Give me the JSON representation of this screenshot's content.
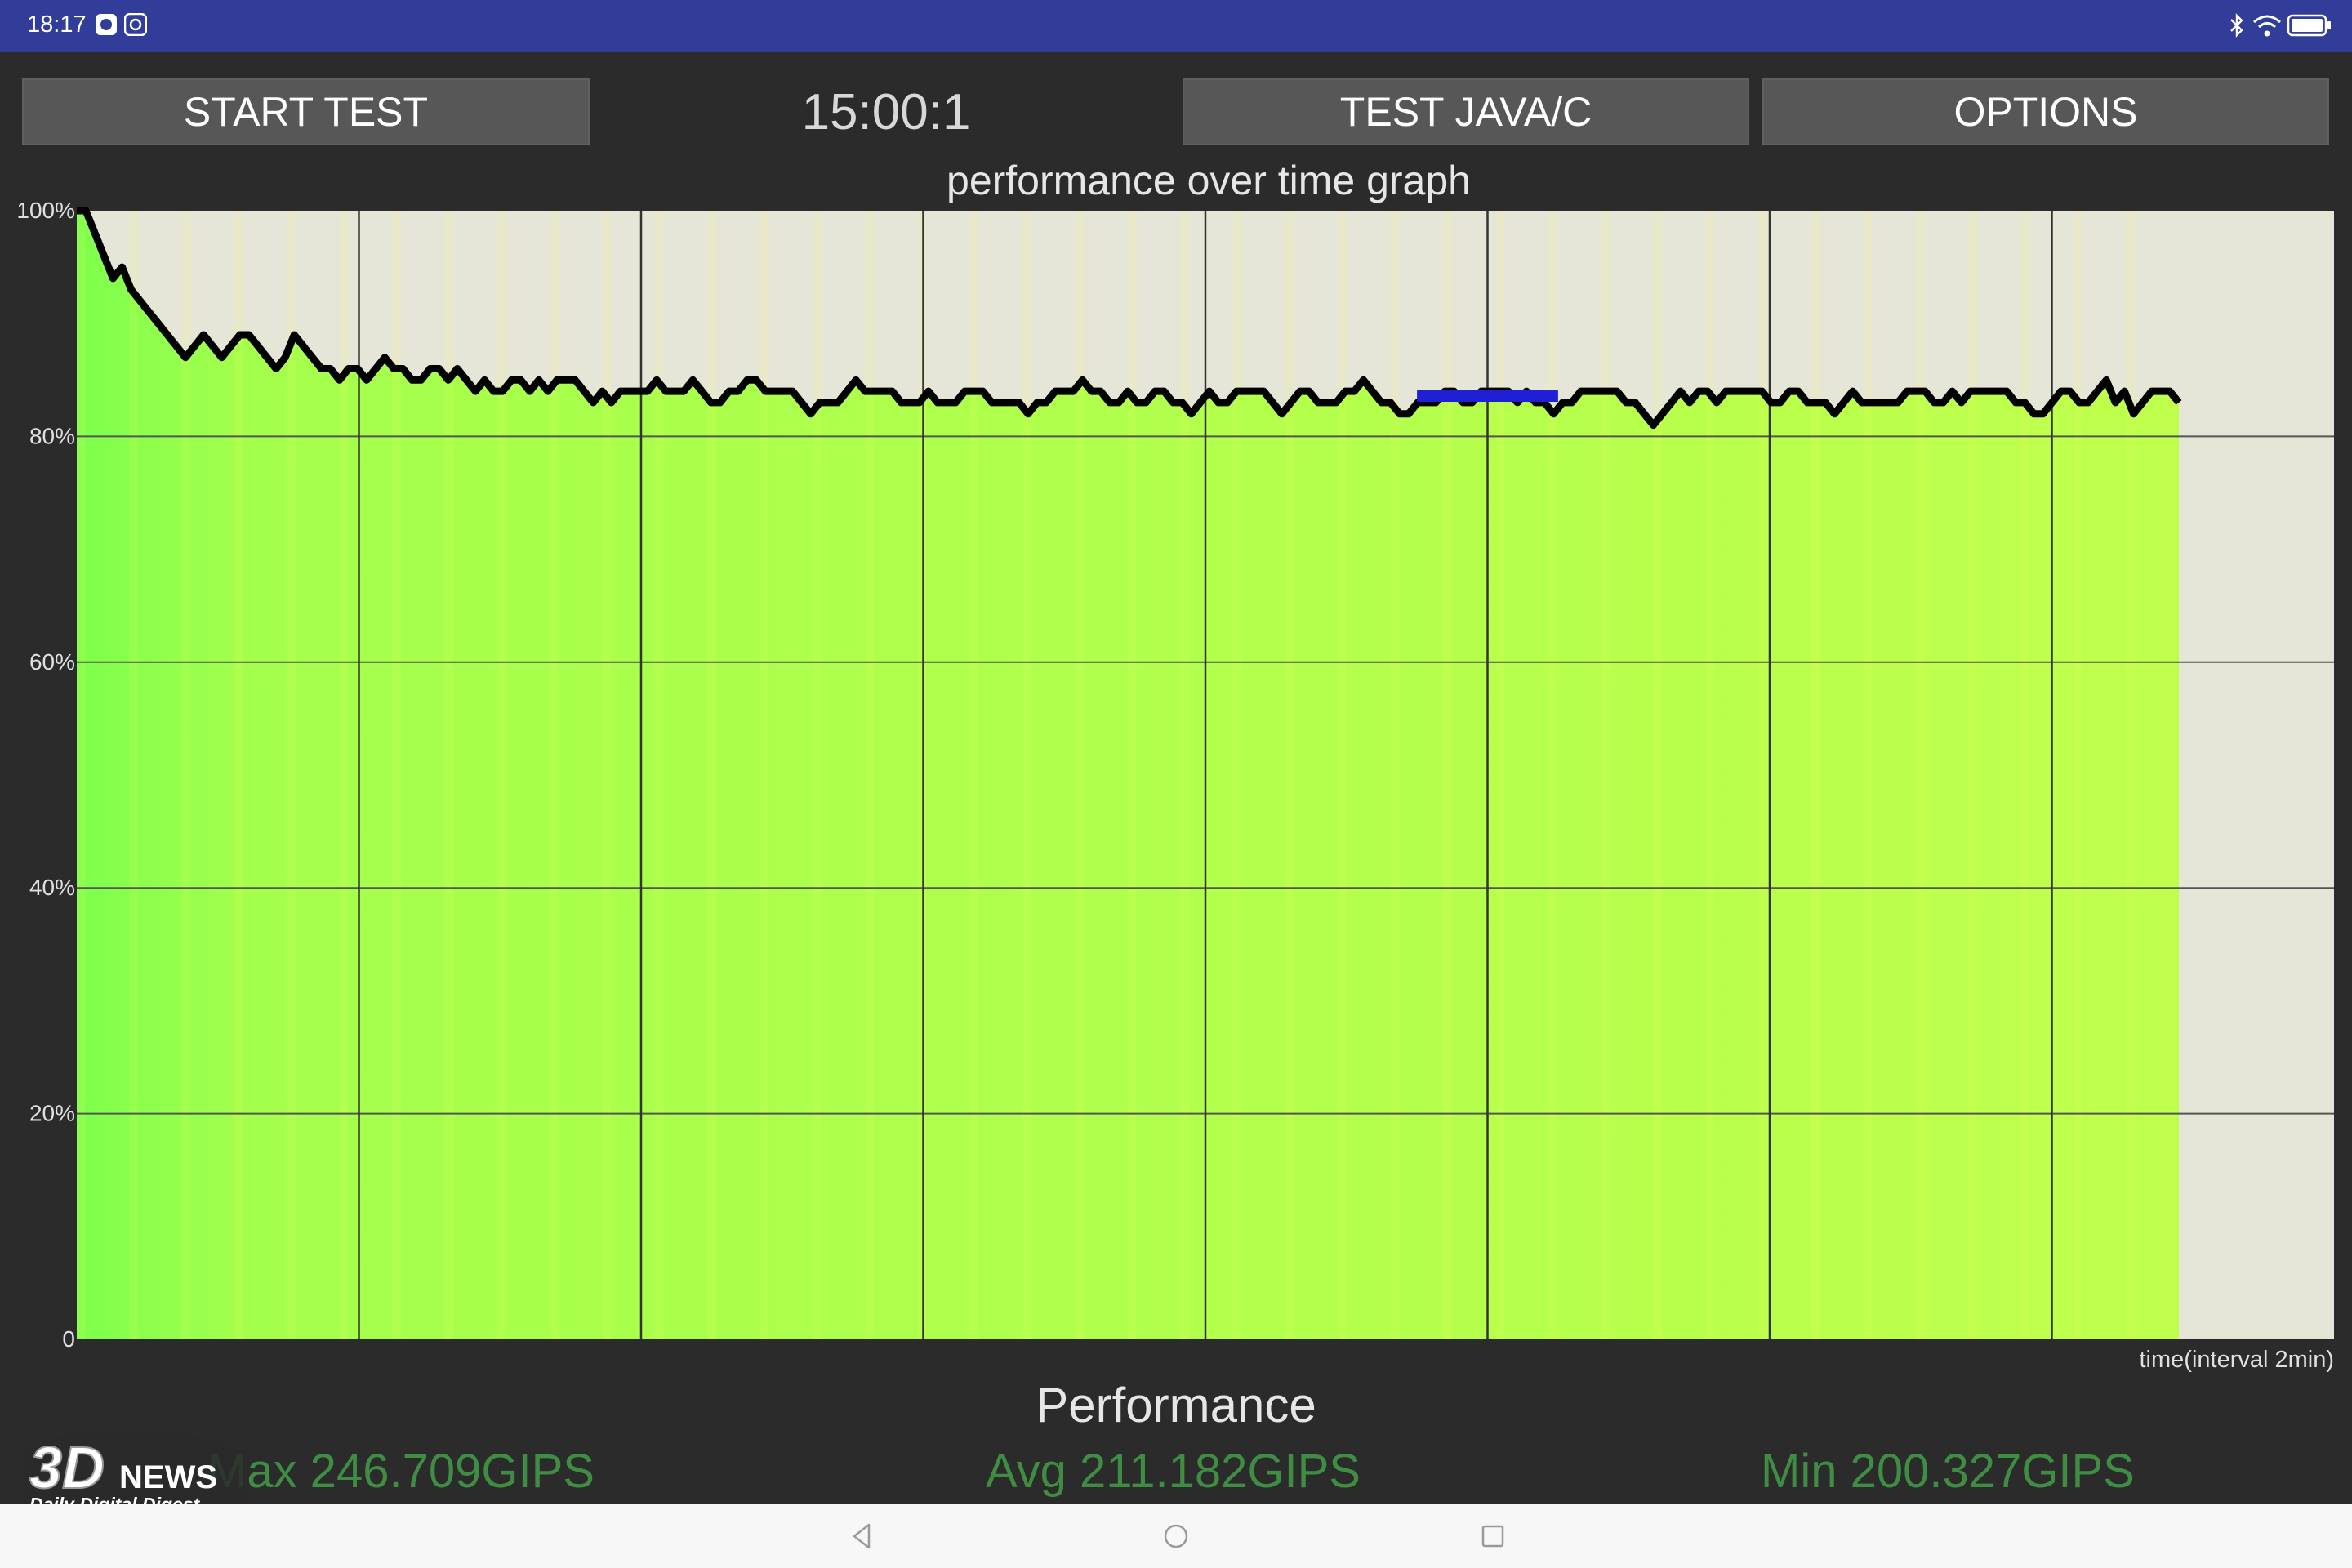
{
  "status_bar": {
    "time": "18:17",
    "left_icons": [
      "app-notification-icon",
      "settings-notification-icon"
    ],
    "right_icons": [
      "bluetooth-icon",
      "wifi-icon",
      "battery-icon"
    ]
  },
  "toolbar": {
    "start_label": "START TEST",
    "timer": "15:00:1",
    "java_label": "TEST JAVA/C",
    "options_label": "OPTIONS"
  },
  "chart_data": {
    "type": "area",
    "title": "performance over time graph",
    "xlabel": "time(interval 2min)",
    "ylabel": "",
    "ytick_labels": [
      "100%",
      "80%",
      "60%",
      "40%",
      "20%",
      "0"
    ],
    "ylim": [
      0,
      100
    ],
    "x_interval_minutes": 2,
    "xlim_minutes": [
      0,
      16
    ],
    "grid": true,
    "colors": {
      "fill_start": "#7cff4c",
      "fill_end": "#bfff4c",
      "line": "#000000",
      "highlight": "#1f1fd6",
      "empty": "#e6e6d8"
    },
    "series": [
      {
        "values": [
          100,
          100,
          98,
          96,
          94,
          95,
          93,
          92,
          91,
          90,
          89,
          88,
          87,
          88,
          89,
          88,
          87,
          88,
          89,
          89,
          88,
          87,
          86,
          87,
          89,
          88,
          87,
          86,
          86,
          85,
          86,
          86,
          85,
          86,
          87,
          86,
          86,
          85,
          85,
          86,
          86,
          85,
          86,
          85,
          84,
          85,
          84,
          84,
          85,
          85,
          84,
          85,
          84,
          85,
          85,
          85,
          84,
          83,
          84,
          83,
          84,
          84,
          84,
          84,
          85,
          84,
          84,
          84,
          85,
          84,
          83,
          83,
          84,
          84,
          85,
          85,
          84,
          84,
          84,
          84,
          83,
          82,
          83,
          83,
          83,
          84,
          85,
          84,
          84,
          84,
          84,
          83,
          83,
          83,
          84,
          83,
          83,
          83,
          84,
          84,
          84,
          83,
          83,
          83,
          83,
          82,
          83,
          83,
          84,
          84,
          84,
          85,
          84,
          84,
          83,
          83,
          84,
          83,
          83,
          84,
          84,
          83,
          83,
          82,
          83,
          84,
          83,
          83,
          84,
          84,
          84,
          84,
          83,
          82,
          83,
          84,
          84,
          83,
          83,
          83,
          84,
          84,
          85,
          84,
          83,
          83,
          82,
          82,
          83,
          83,
          83,
          84,
          84,
          83,
          83,
          84,
          84,
          84,
          84,
          83,
          84,
          83,
          83,
          82,
          83,
          83,
          84,
          84,
          84,
          84,
          84,
          83,
          83,
          82,
          81,
          82,
          83,
          84,
          83,
          84,
          84,
          83,
          84,
          84,
          84,
          84,
          84,
          83,
          83,
          84,
          84,
          83,
          83,
          83,
          82,
          83,
          84,
          83,
          83,
          83,
          83,
          83,
          84,
          84,
          84,
          83,
          83,
          84,
          83,
          84,
          84,
          84,
          84,
          84,
          83,
          83,
          82,
          82,
          83,
          84,
          84,
          83,
          83,
          84,
          85,
          83,
          84,
          82,
          83,
          84,
          84,
          84,
          83
        ]
      }
    ],
    "highlight_segment": {
      "x_start_minutes": 9.5,
      "x_end_minutes": 10.5,
      "value": 83.5
    }
  },
  "performance": {
    "title": "Performance",
    "max": "Max 246.709GIPS",
    "avg": "Avg 211.182GIPS",
    "min": "Min 200.327GIPS"
  },
  "watermark": {
    "brand": "3DNEWS",
    "tagline": "Daily Digital Digest"
  },
  "nav_bar": {
    "icons": [
      "back-icon",
      "home-icon",
      "recents-icon"
    ]
  }
}
